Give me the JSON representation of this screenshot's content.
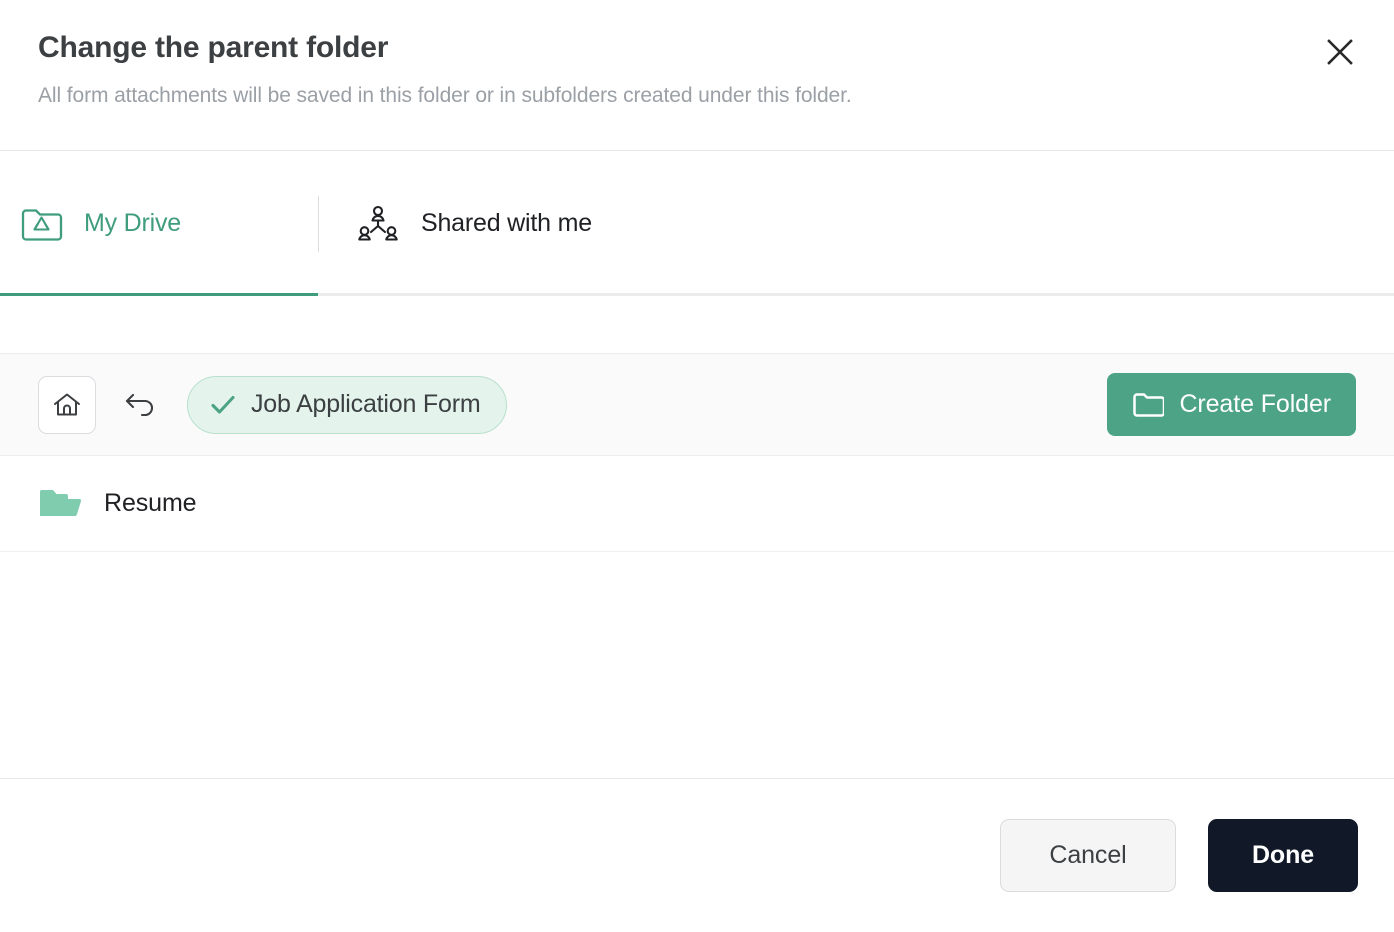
{
  "dialog": {
    "title": "Change the parent folder",
    "subtitle": "All form attachments will be saved in this folder or in subfolders created under this folder.",
    "close_label": "close-icon"
  },
  "tabs": [
    {
      "id": "my-drive",
      "label": "My Drive",
      "icon": "drive-folder-icon",
      "active": true
    },
    {
      "id": "shared-with-me",
      "label": "Shared with me",
      "icon": "people-group-icon",
      "active": false
    }
  ],
  "toolbar": {
    "home_icon": "home-icon",
    "undo_icon": "undo-arrow-icon",
    "breadcrumb": {
      "label": "Job Application Form",
      "check_icon": "check-icon",
      "selected": true
    },
    "create_folder": {
      "label": "Create Folder",
      "icon": "folder-outline-icon"
    }
  },
  "file_list": {
    "items": [
      {
        "name": "Resume",
        "icon": "open-folder-icon",
        "type": "folder"
      }
    ]
  },
  "footer": {
    "cancel_label": "Cancel",
    "done_label": "Done"
  },
  "colors": {
    "accent_green": "#4ca385",
    "tab_active_green": "#3f9d7d",
    "chip_background": "#e4f4ec",
    "chip_border": "#b8e0cd",
    "folder_mint": "#7fccaf",
    "done_dark": "#111827",
    "subtitle_gray": "#9aa0a6",
    "title_gray": "#3c4043"
  }
}
